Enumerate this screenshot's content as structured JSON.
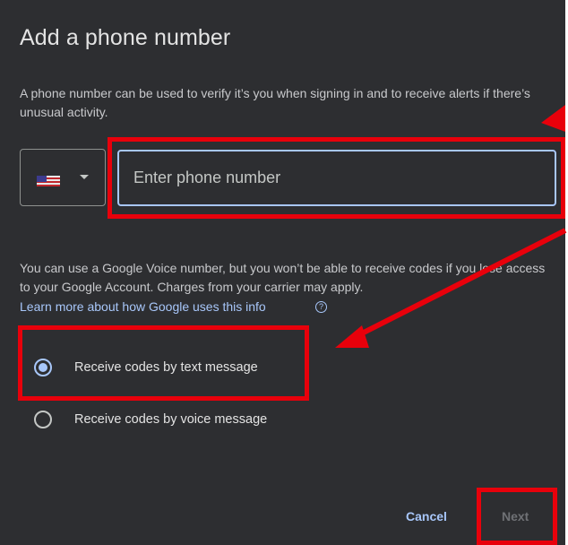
{
  "dialog": {
    "title": "Add a phone number",
    "description": "A phone number can be used to verify it’s you when signing in and to receive alerts if there’s unusual activity."
  },
  "phone": {
    "country_flag": "flag-us",
    "placeholder": "Enter phone number",
    "value": ""
  },
  "voice_note": "You can use a Google Voice number, but you won’t be able to receive codes if you lose access to your Google Account. Charges from your carrier may apply.",
  "learn_more": "Learn more about how Google uses this info",
  "options": [
    {
      "label": "Receive codes by text message",
      "checked": true
    },
    {
      "label": "Receive codes by voice message",
      "checked": false
    }
  ],
  "actions": {
    "cancel": "Cancel",
    "next": "Next"
  },
  "colors": {
    "background": "#2d2e31",
    "accent": "#a8c7fa",
    "annotation": "#e8000b"
  }
}
